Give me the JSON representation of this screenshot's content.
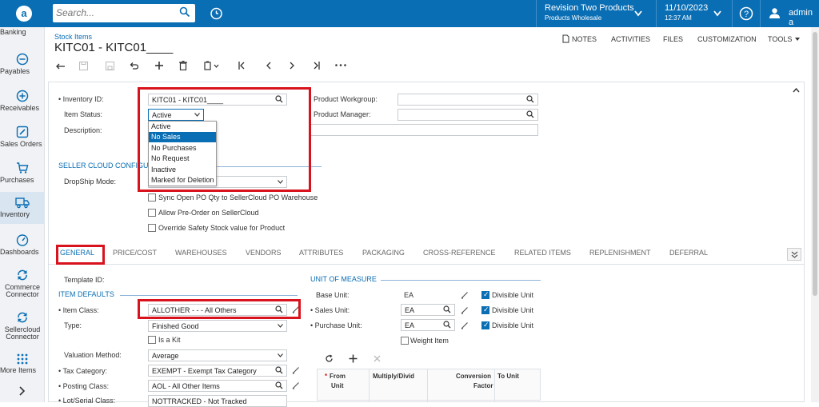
{
  "header": {
    "search_placeholder": "Search...",
    "company_name": "Revision Two Products",
    "company_branch": "Products Wholesale",
    "date": "11/10/2023",
    "time": "12:37 AM",
    "user": "admin a"
  },
  "sidebar": {
    "items": [
      {
        "label": "Banking",
        "icon": "bank-icon"
      },
      {
        "label": "Payables",
        "icon": "minus-circle-icon"
      },
      {
        "label": "Receivables",
        "icon": "plus-circle-icon"
      },
      {
        "label": "Sales Orders",
        "icon": "pencil-icon"
      },
      {
        "label": "Purchases",
        "icon": "cart-icon"
      },
      {
        "label": "Inventory",
        "icon": "truck-icon"
      },
      {
        "label": "Dashboards",
        "icon": "gauge-icon"
      },
      {
        "label": "Commerce Connector",
        "icon": "sync-icon"
      },
      {
        "label": "Sellercloud Connector",
        "icon": "sync-icon"
      },
      {
        "label": "More Items",
        "icon": "grid-icon"
      }
    ]
  },
  "page": {
    "breadcrumb": "Stock Items",
    "title": "KITC01 - KITC01____"
  },
  "topright": {
    "notes": "NOTES",
    "activities": "ACTIVITIES",
    "files": "FILES",
    "customization": "CUSTOMIZATION",
    "tools": "TOOLS"
  },
  "form": {
    "inventory_id_label": "Inventory ID:",
    "inventory_id_value": "KITC01 - KITC01____",
    "item_status_label": "Item Status:",
    "item_status_value": "Active",
    "description_label": "Description:",
    "product_workgroup_label": "Product Workgroup:",
    "product_manager_label": "Product Manager:",
    "status_options": [
      "Active",
      "No Sales",
      "No Purchases",
      "No Request",
      "Inactive",
      "Marked for Deletion"
    ],
    "status_selected_index": 1,
    "seller_cloud_section": "SELLER CLOUD CONFIGU",
    "dropship_label": "DropShip Mode:",
    "sync_po_label": "Sync Open PO Qty to SellerCloud PO Warehouse",
    "allow_preorder_label": "Allow Pre-Order on SellerCloud",
    "override_safety_label": "Override Safety Stock value for Product"
  },
  "tabs": [
    "GENERAL",
    "PRICE/COST",
    "WAREHOUSES",
    "VENDORS",
    "ATTRIBUTES",
    "PACKAGING",
    "CROSS-REFERENCE",
    "RELATED ITEMS",
    "REPLENISHMENT",
    "DEFERRAL"
  ],
  "general": {
    "template_id_label": "Template ID:",
    "item_defaults_section": "ITEM DEFAULTS",
    "item_class_label": "Item Class:",
    "item_class_value": "ALLOTHER  -   - - All Others",
    "type_label": "Type:",
    "type_value": "Finished Good",
    "is_kit_label": "Is a Kit",
    "valuation_label": "Valuation Method:",
    "valuation_value": "Average",
    "tax_category_label": "Tax Category:",
    "tax_category_value": "EXEMPT - Exempt Tax Category",
    "posting_class_label": "Posting Class:",
    "posting_class_value": "AOL - All Other Items",
    "lot_serial_label": "Lot/Serial Class:",
    "lot_serial_value": "NOTTRACKED - Not Tracked",
    "uom_section": "UNIT OF MEASURE",
    "base_unit_label": "Base Unit:",
    "base_unit_value": "EA",
    "sales_unit_label": "Sales Unit:",
    "sales_unit_value": "EA",
    "purchase_unit_label": "Purchase Unit:",
    "purchase_unit_value": "EA",
    "divisible_label": "Divisible Unit",
    "weight_item_label": "Weight Item",
    "grid_from": "From",
    "grid_from2": "Unit",
    "grid_multiply": "Multiply/Divid",
    "grid_conversion": "Conversion",
    "grid_conversion2": "Factor",
    "grid_to": "To Unit"
  }
}
